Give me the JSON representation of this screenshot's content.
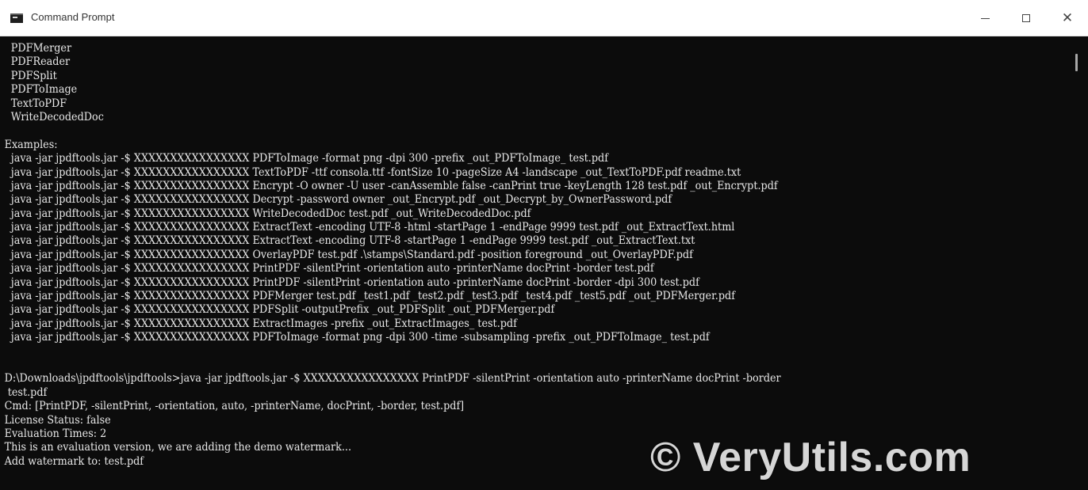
{
  "window": {
    "title": "Command Prompt",
    "icons": {
      "app": "cmd-icon",
      "minimize": "minimize-icon",
      "maximize": "maximize-icon",
      "close": "close-icon"
    },
    "close_glyph": "✕"
  },
  "console": {
    "lines": [
      "  PDFMerger",
      "  PDFReader",
      "  PDFSplit",
      "  PDFToImage",
      "  TextToPDF",
      "  WriteDecodedDoc",
      "",
      "Examples:",
      "  java -jar jpdftools.jar -$ XXXXXXXXXXXXXXXX PDFToImage -format png -dpi 300 -prefix _out_PDFToImage_ test.pdf",
      "  java -jar jpdftools.jar -$ XXXXXXXXXXXXXXXX TextToPDF -ttf consola.ttf -fontSize 10 -pageSize A4 -landscape _out_TextToPDF.pdf readme.txt",
      "  java -jar jpdftools.jar -$ XXXXXXXXXXXXXXXX Encrypt -O owner -U user -canAssemble false -canPrint true -keyLength 128 test.pdf _out_Encrypt.pdf",
      "  java -jar jpdftools.jar -$ XXXXXXXXXXXXXXXX Decrypt -password owner _out_Encrypt.pdf _out_Decrypt_by_OwnerPassword.pdf",
      "  java -jar jpdftools.jar -$ XXXXXXXXXXXXXXXX WriteDecodedDoc test.pdf _out_WriteDecodedDoc.pdf",
      "  java -jar jpdftools.jar -$ XXXXXXXXXXXXXXXX ExtractText -encoding UTF-8 -html -startPage 1 -endPage 9999 test.pdf _out_ExtractText.html",
      "  java -jar jpdftools.jar -$ XXXXXXXXXXXXXXXX ExtractText -encoding UTF-8 -startPage 1 -endPage 9999 test.pdf _out_ExtractText.txt",
      "  java -jar jpdftools.jar -$ XXXXXXXXXXXXXXXX OverlayPDF test.pdf .\\stamps\\Standard.pdf -position foreground _out_OverlayPDF.pdf",
      "  java -jar jpdftools.jar -$ XXXXXXXXXXXXXXXX PrintPDF -silentPrint -orientation auto -printerName docPrint -border test.pdf",
      "  java -jar jpdftools.jar -$ XXXXXXXXXXXXXXXX PrintPDF -silentPrint -orientation auto -printerName docPrint -border -dpi 300 test.pdf",
      "  java -jar jpdftools.jar -$ XXXXXXXXXXXXXXXX PDFMerger test.pdf _test1.pdf _test2.pdf _test3.pdf _test4.pdf _test5.pdf _out_PDFMerger.pdf",
      "  java -jar jpdftools.jar -$ XXXXXXXXXXXXXXXX PDFSplit -outputPrefix _out_PDFSplit _out_PDFMerger.pdf",
      "  java -jar jpdftools.jar -$ XXXXXXXXXXXXXXXX ExtractImages -prefix _out_ExtractImages_ test.pdf",
      "  java -jar jpdftools.jar -$ XXXXXXXXXXXXXXXX PDFToImage -format png -dpi 300 -time -subsampling -prefix _out_PDFToImage_ test.pdf",
      "",
      "",
      "D:\\Downloads\\jpdftools\\jpdftools>java -jar jpdftools.jar -$ XXXXXXXXXXXXXXXX PrintPDF -silentPrint -orientation auto -printerName docPrint -border",
      " test.pdf",
      "Cmd: [PrintPDF, -silentPrint, -orientation, auto, -printerName, docPrint, -border, test.pdf]",
      "License Status: false",
      "Evaluation Times: 2",
      "This is an evaluation version, we are adding the demo watermark...",
      "Add watermark to: test.pdf"
    ]
  },
  "watermark": "© VeryUtils.com"
}
